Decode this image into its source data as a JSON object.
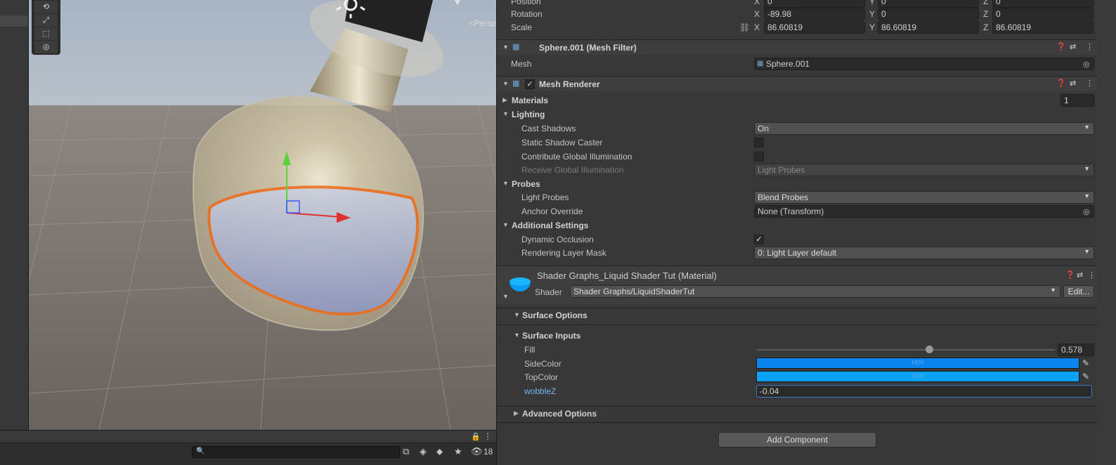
{
  "scene": {
    "tools": [
      "⟲",
      "⤢",
      "⬚",
      "◎"
    ],
    "view_mode": "<Persp"
  },
  "bottom_bar": {
    "search_placeholder": "",
    "hidden_count": "18"
  },
  "transform": {
    "position_label": "Position",
    "position": {
      "x": "0",
      "y": "0",
      "z": "0"
    },
    "rotation_label": "Rotation",
    "rotation": {
      "x": "-89.98",
      "y": "0",
      "z": "0"
    },
    "scale_label": "Scale",
    "scale": {
      "x": "86.60819",
      "y": "86.60819",
      "z": "86.60819"
    }
  },
  "mesh_filter": {
    "title": "Sphere.001 (Mesh Filter)",
    "mesh_label": "Mesh",
    "mesh_value": "Sphere.001"
  },
  "mesh_renderer": {
    "title": "Mesh Renderer",
    "enabled": true,
    "materials_label": "Materials",
    "materials_count": "1",
    "lighting_label": "Lighting",
    "cast_shadows_label": "Cast Shadows",
    "cast_shadows_value": "On",
    "static_shadow_caster_label": "Static Shadow Caster",
    "static_shadow_caster": false,
    "contribute_gi_label": "Contribute Global Illumination",
    "contribute_gi": false,
    "receive_gi_label": "Receive Global Illumination",
    "receive_gi_value": "Light Probes",
    "probes_label": "Probes",
    "light_probes_label": "Light Probes",
    "light_probes_value": "Blend Probes",
    "anchor_override_label": "Anchor Override",
    "anchor_override_value": "None (Transform)",
    "additional_settings_label": "Additional Settings",
    "dynamic_occlusion_label": "Dynamic Occlusion",
    "dynamic_occlusion": true,
    "rendering_layer_mask_label": "Rendering Layer Mask",
    "rendering_layer_mask_value": "0: Light Layer default"
  },
  "material": {
    "title": "Shader Graphs_Liquid Shader Tut (Material)",
    "shader_label": "Shader",
    "shader_value": "Shader Graphs/LiquidShaderTut",
    "edit_label": "Edit...",
    "surface_options_label": "Surface Options",
    "surface_inputs_label": "Surface Inputs",
    "fill_label": "Fill",
    "fill_value": "0.578",
    "fill_fraction": 0.578,
    "side_color_label": "SideColor",
    "top_color_label": "TopColor",
    "hdr_tag": "HDR",
    "side_color": "#0a85f0",
    "top_color": "#0aa2f5",
    "wobble_label": "wobbleZ",
    "wobble_value": "-0.04",
    "advanced_options_label": "Advanced Options"
  },
  "add_component_label": "Add Component"
}
